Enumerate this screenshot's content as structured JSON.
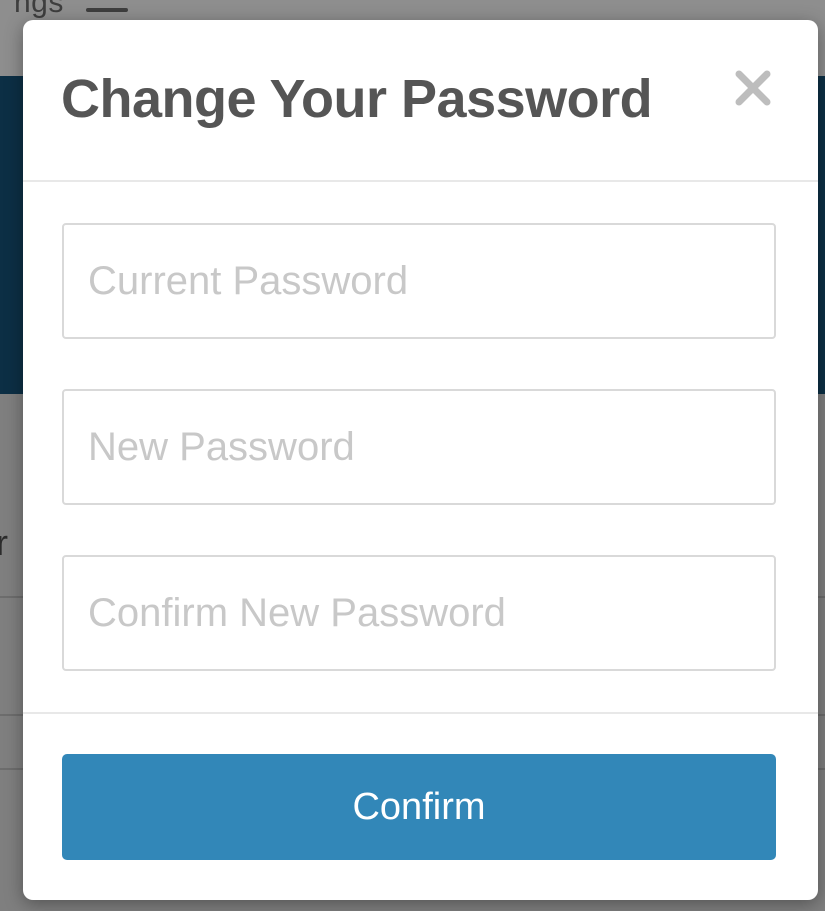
{
  "background": {
    "topbar_text": "ngs"
  },
  "modal": {
    "title": "Change Your Password",
    "close_icon": "close-icon",
    "fields": {
      "current_password": {
        "placeholder": "Current Password",
        "value": ""
      },
      "new_password": {
        "placeholder": "New Password",
        "value": ""
      },
      "confirm_new_password": {
        "placeholder": "Confirm New Password",
        "value": ""
      }
    },
    "confirm_label": "Confirm"
  },
  "colors": {
    "accent": "#3287b8",
    "title": "#555555",
    "placeholder": "#c8c8c8",
    "overlay": "#7b7b7b",
    "hero": "#0c2f45"
  }
}
